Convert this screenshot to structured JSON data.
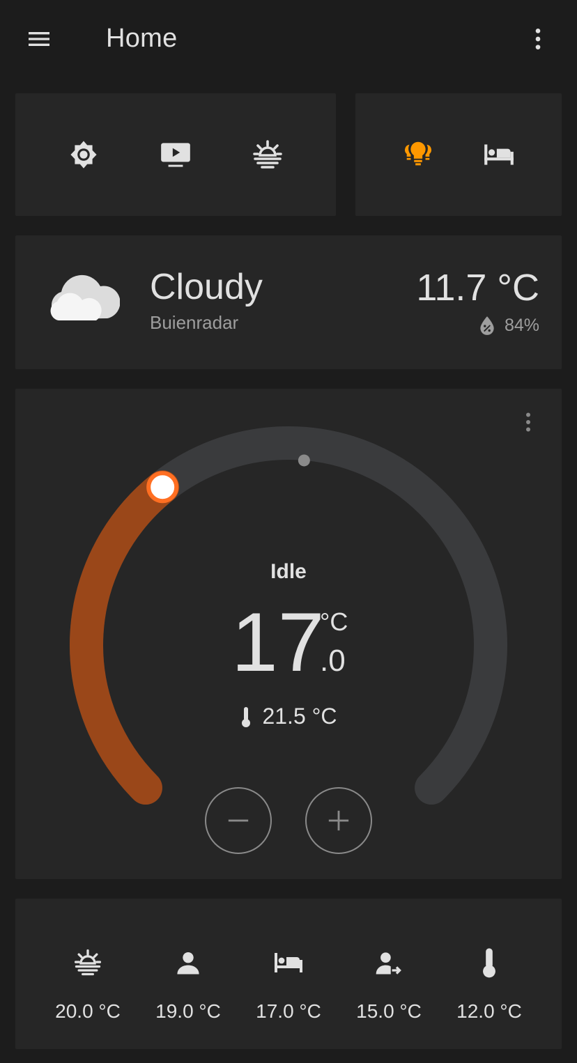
{
  "app_bar": {
    "title": "Home",
    "menu_icon": "menu-icon",
    "overflow_icon": "dots-vertical-icon"
  },
  "scene_buttons": [
    {
      "icon": "brightness-icon",
      "state": "off"
    },
    {
      "icon": "television-play-icon",
      "state": "off"
    },
    {
      "icon": "weather-sunset-icon",
      "state": "off"
    }
  ],
  "light_buttons": [
    {
      "icon": "lightbulb-group-icon",
      "state": "on",
      "color": "#ff9800"
    },
    {
      "icon": "bed-icon",
      "state": "off"
    }
  ],
  "weather": {
    "condition": "Cloudy",
    "source": "Buienradar",
    "temperature": "11.7 °C",
    "humidity": "84%",
    "icon": "cloudy-icon",
    "humidity_icon": "water-percent-icon"
  },
  "thermostat": {
    "hvac_action": "Idle",
    "target_integer": "17",
    "target_decimal": ".0",
    "unit": "°C",
    "current_temperature": "21.5 °C",
    "target_value": 17.0,
    "current_value": 21.5,
    "range": [
      7,
      35
    ],
    "active_color": "#9a4719",
    "handle_color": "#ff6f22",
    "track_color": "#3a3b3d",
    "decrease_icon": "minus-icon",
    "increase_icon": "plus-icon"
  },
  "presets": [
    {
      "icon": "weather-sunset-icon",
      "label": "20.0 °C"
    },
    {
      "icon": "account-icon",
      "label": "19.0 °C"
    },
    {
      "icon": "bed-icon",
      "label": "17.0 °C"
    },
    {
      "icon": "account-arrow-right-icon",
      "label": "15.0 °C"
    },
    {
      "icon": "thermometer-icon",
      "label": "12.0 °C"
    }
  ]
}
